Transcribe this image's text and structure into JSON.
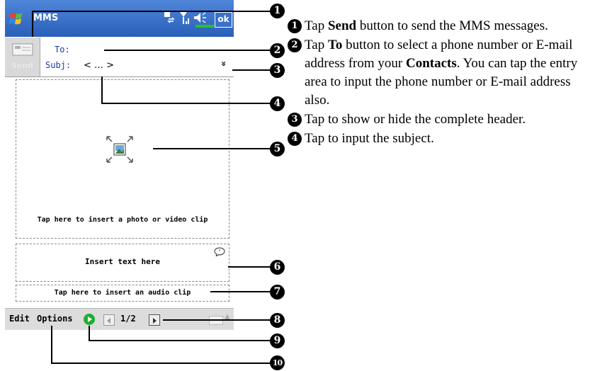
{
  "device": {
    "app_title": "MMS",
    "ok_label": "ok",
    "send_label": "Send",
    "to_label": "To:",
    "subject_label": "Subj:",
    "subject_value": "< … >",
    "expand_glyph": "»",
    "photo_prompt": "Tap here to insert a photo or video clip",
    "text_prompt": "Insert text here",
    "audio_prompt": "Tap here to insert an audio clip",
    "menu": {
      "edit": "Edit",
      "options": "Options"
    },
    "page_indicator": "1/2"
  },
  "callouts": [
    "1",
    "2",
    "3",
    "4",
    "5",
    "6",
    "7",
    "8",
    "9",
    "10"
  ],
  "instructions": [
    {
      "num": "1",
      "pre": "Tap ",
      "bold": "Send",
      "post": " button to send the MMS messages."
    },
    {
      "num": "2",
      "pre": "Tap ",
      "bold": "To",
      "post": " button to select a phone number or E-mail address from your ",
      "bold2": "Contacts",
      "post2": ". You can tap the entry area to input the phone number or E-mail address also."
    },
    {
      "num": "3",
      "pre": "Tap to show or hide the complete header.",
      "bold": "",
      "post": ""
    },
    {
      "num": "4",
      "pre": "Tap to input the subject.",
      "bold": "",
      "post": ""
    }
  ],
  "colors": {
    "titlebar": "#2a5fb9",
    "label_blue": "#1a3aa6",
    "play_green": "#1fae33"
  }
}
